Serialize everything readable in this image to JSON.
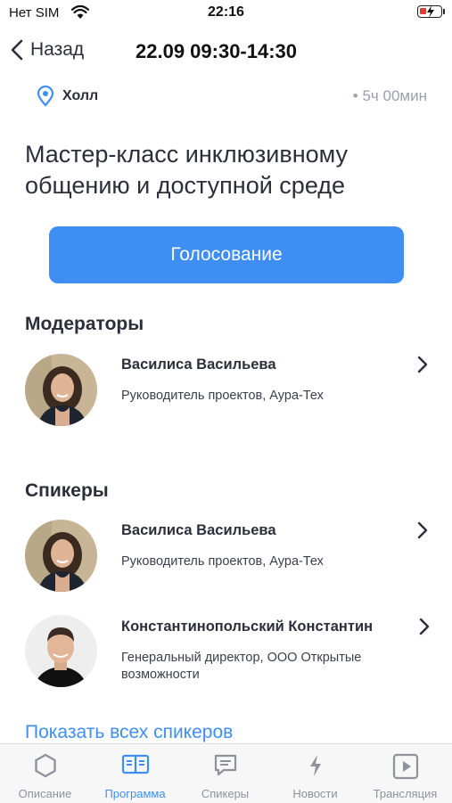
{
  "status_bar": {
    "carrier": "Нет SIM",
    "time": "22:16"
  },
  "nav": {
    "back_label": "Назад",
    "title": "22.09 09:30-14:30"
  },
  "event": {
    "location": "Холл",
    "duration": "• 5ч 00мин",
    "title": "Мастер-класс инклюзивному общению и доступной среде",
    "vote_label": "Голосование"
  },
  "moderators": {
    "section_title": "Модераторы",
    "items": [
      {
        "name": "Василиса Васильева",
        "role": "Руководитель проектов, Аура-Тех"
      }
    ]
  },
  "speakers": {
    "section_title": "Спикеры",
    "items": [
      {
        "name": "Василиса Васильева",
        "role": "Руководитель проектов, Аура-Тех"
      },
      {
        "name": "Константинопольский Константин",
        "role": "Генеральный директор, ООО Открытые возможности"
      }
    ],
    "show_all_label": "Показать всех спикеров"
  },
  "tabbar": {
    "tabs": [
      {
        "label": "Описание",
        "icon": "hexagon-icon"
      },
      {
        "label": "Программа",
        "icon": "book-icon",
        "active": true
      },
      {
        "label": "Спикеры",
        "icon": "message-icon"
      },
      {
        "label": "Новости",
        "icon": "lightning-icon"
      },
      {
        "label": "Трансляция",
        "icon": "play-icon"
      }
    ]
  },
  "colors": {
    "accent": "#3f8ef3",
    "text": "#2b2f3a",
    "muted": "#9aa0ad",
    "tab_inactive": "#8e929b"
  }
}
